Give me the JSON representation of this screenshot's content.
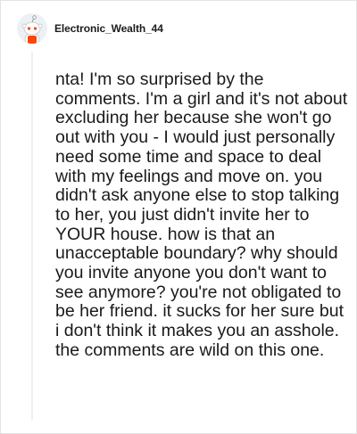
{
  "comment": {
    "author": "Electronic_Wealth_44",
    "avatar_icon": "reddit-snoo-avatar-icon",
    "body": "nta! I'm so surprised by the comments. I'm a girl and it's not about excluding her because she won't go out with you - I would just personally need some time and space to deal with my feelings and move on. you didn't ask anyone else to stop talking to her, you just didn't invite her to YOUR house. how is that an unacceptable boundary? why should you invite anyone you don't want to see anymore? you're not obligated to be her friend. it sucks for her sure but i don't think it makes you an asshole. the comments are wild on this one."
  },
  "colors": {
    "text": "#1a1a1b",
    "border": "#e3e3e3",
    "thread_line": "#edeff1",
    "avatar_accent": "#ff4500"
  }
}
